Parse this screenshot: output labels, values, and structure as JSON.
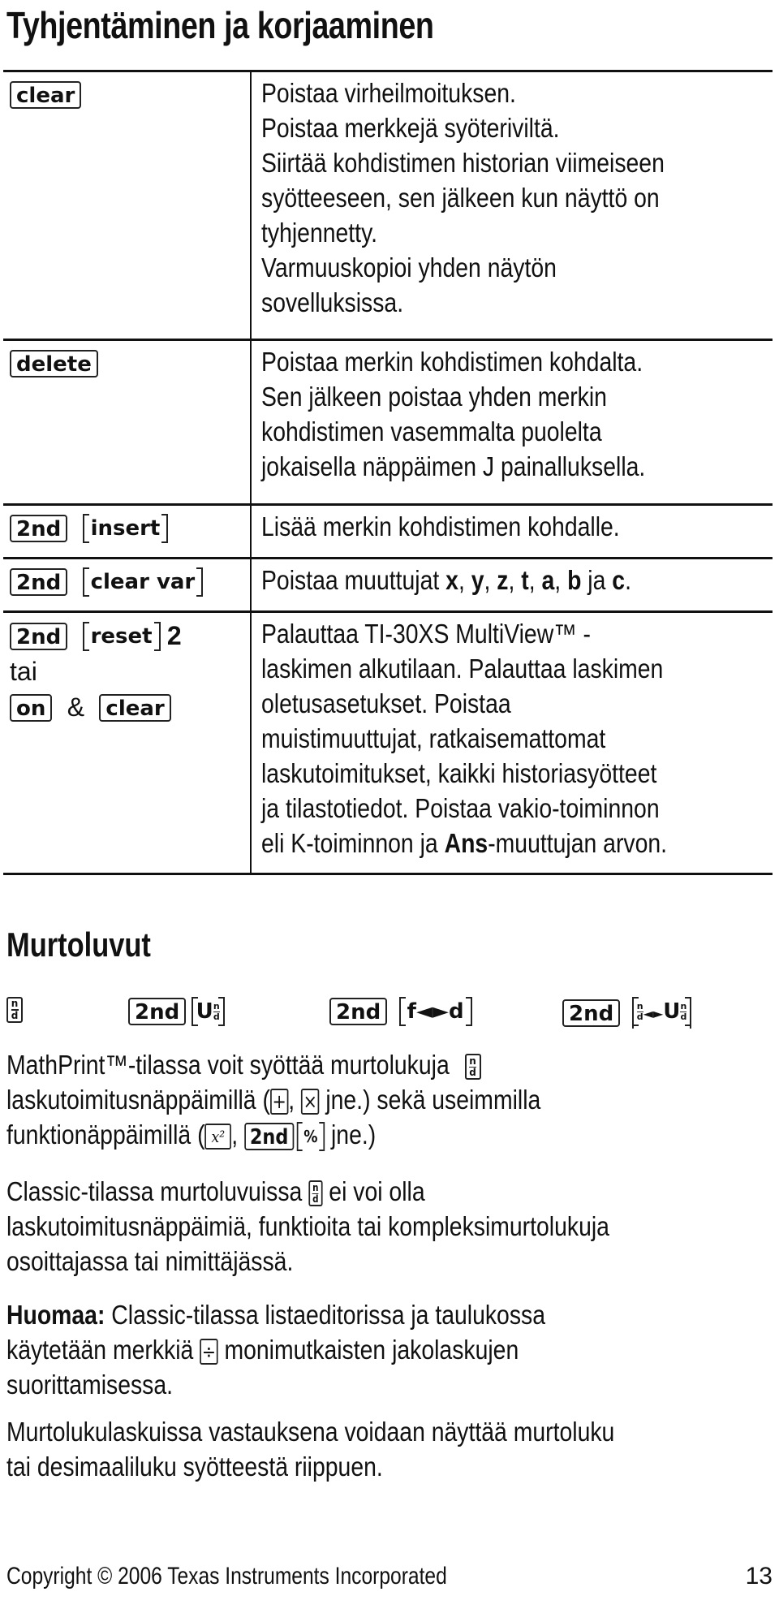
{
  "section1": {
    "title": "Tyhjentäminen ja korjaaminen",
    "rows": [
      {
        "keys": {
          "k1": "clear"
        },
        "lines": [
          "Poistaa virheilmoituksen.",
          "Poistaa merkkejä syöteriviltä.",
          "Siirtää kohdistimen historian viimeiseen",
          "syötteeseen, sen jälkeen kun näyttö on",
          "tyhjennetty.",
          "Varmuuskopioi yhden näytön",
          "sovelluksissa."
        ]
      },
      {
        "keys": {
          "k1": "delete"
        },
        "lines": [
          "Poistaa merkin kohdistimen kohdalta.",
          "Sen jälkeen poistaa yhden merkin",
          "kohdistimen vasemmalta puolelta",
          "jokaisella näppäimen J painalluksella."
        ]
      },
      {
        "keys": {
          "k1": "2nd",
          "k2": "insert"
        },
        "lines": [
          "Lisää merkin kohdistimen kohdalle."
        ]
      },
      {
        "keys": {
          "k1": "2nd",
          "k2": "clear var"
        },
        "text_prefix": "Poistaa muuttujat ",
        "vars": [
          "x",
          "y",
          "z",
          "t",
          "a",
          "b"
        ],
        "sep": ", ",
        "and_word": " ja ",
        "last_var": "c",
        "end": "."
      },
      {
        "keys": {
          "k1": "2nd",
          "k2": "reset",
          "k3": "2",
          "or": "tai",
          "k4": "on",
          "amp": "&",
          "k5": "clear"
        },
        "lines": [
          "Palauttaa TI-30XS MultiView™ -",
          "laskimen alkutilaan. Palauttaa laskimen",
          "oletusasetukset. Poistaa",
          "muistimuuttujat, ratkaisemattomat",
          "laskutoimitukset, kaikki historiasyötteet",
          "ja tilastotiedot. Poistaa vakio-toiminnon"
        ],
        "last_prefix": "eli K-toiminnon ja ",
        "last_bold": "Ans",
        "last_suffix": "-muuttujan arvon."
      }
    ]
  },
  "section2": {
    "title": "Murtoluvut",
    "fraction_keys": {
      "nd_top": "n",
      "nd_bottom": "d",
      "second": "2nd",
      "mixed_u": "U",
      "fd_label": "f◄►d",
      "arrows": "◄►"
    },
    "p1": {
      "l1": "MathPrint™-tilassa voit syöttää murtolukuja",
      "l2a": "laskutoimitusnäppäimillä (",
      "plus": "+",
      "comma": ", ",
      "times": "×",
      "l2b": " jne.) sekä useimmilla",
      "l3a": "funktionäppäimillä (",
      "x2": "x²",
      "second": "2nd",
      "percent": "%",
      "l3b": " jne.)"
    },
    "p2": {
      "l1a": "Classic-tilassa murtoluvuissa",
      "l1b": " ei voi olla",
      "l2": "laskutoimitusnäppäimiä, funktioita tai kompleksimurtolukuja",
      "l3": "osoittajassa tai nimittäjässä."
    },
    "p3": {
      "bold": "Huomaa:",
      "l1": " Classic-tilassa listaeditorissa ja taulukossa",
      "l2a": "käytetään merkkiä",
      "divide": "÷",
      "l2b": " monimutkaisten jakolaskujen",
      "l3": "suorittamisessa."
    },
    "p4": {
      "l1": "Murtolukulaskuissa vastauksena voidaan näyttää murtoluku",
      "l2": "tai desimaaliluku syötteestä riippuen."
    }
  },
  "footer": {
    "copyright": "Copyright © 2006 Texas Instruments Incorporated",
    "page_number": "13"
  }
}
